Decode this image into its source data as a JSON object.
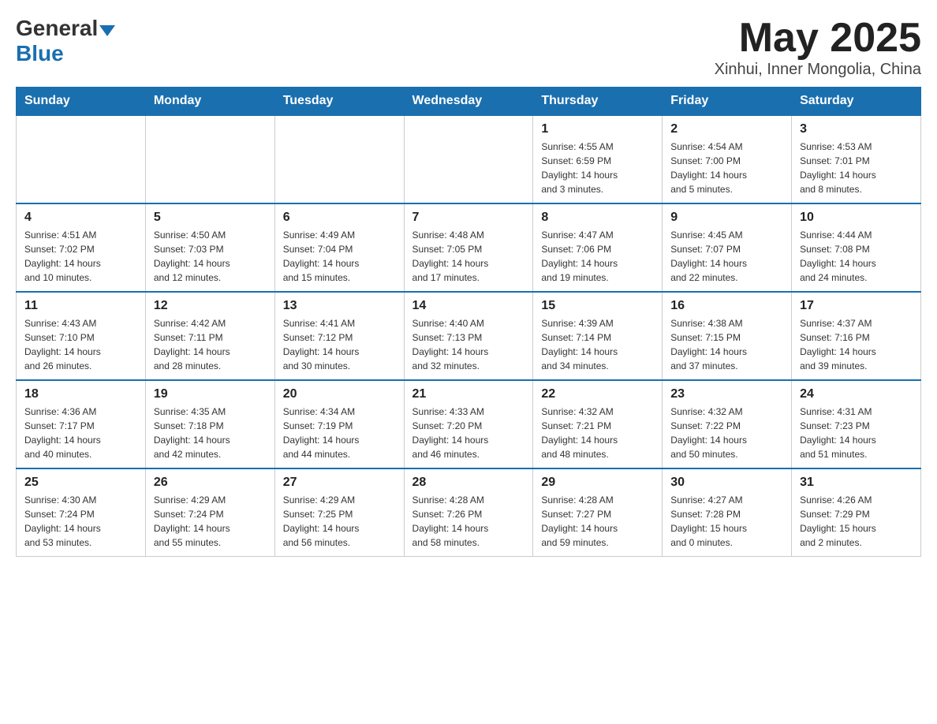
{
  "header": {
    "logo_general": "General",
    "logo_blue": "Blue",
    "month": "May 2025",
    "location": "Xinhui, Inner Mongolia, China"
  },
  "days_of_week": [
    "Sunday",
    "Monday",
    "Tuesday",
    "Wednesday",
    "Thursday",
    "Friday",
    "Saturday"
  ],
  "weeks": [
    [
      {
        "day": "",
        "info": ""
      },
      {
        "day": "",
        "info": ""
      },
      {
        "day": "",
        "info": ""
      },
      {
        "day": "",
        "info": ""
      },
      {
        "day": "1",
        "info": "Sunrise: 4:55 AM\nSunset: 6:59 PM\nDaylight: 14 hours\nand 3 minutes."
      },
      {
        "day": "2",
        "info": "Sunrise: 4:54 AM\nSunset: 7:00 PM\nDaylight: 14 hours\nand 5 minutes."
      },
      {
        "day": "3",
        "info": "Sunrise: 4:53 AM\nSunset: 7:01 PM\nDaylight: 14 hours\nand 8 minutes."
      }
    ],
    [
      {
        "day": "4",
        "info": "Sunrise: 4:51 AM\nSunset: 7:02 PM\nDaylight: 14 hours\nand 10 minutes."
      },
      {
        "day": "5",
        "info": "Sunrise: 4:50 AM\nSunset: 7:03 PM\nDaylight: 14 hours\nand 12 minutes."
      },
      {
        "day": "6",
        "info": "Sunrise: 4:49 AM\nSunset: 7:04 PM\nDaylight: 14 hours\nand 15 minutes."
      },
      {
        "day": "7",
        "info": "Sunrise: 4:48 AM\nSunset: 7:05 PM\nDaylight: 14 hours\nand 17 minutes."
      },
      {
        "day": "8",
        "info": "Sunrise: 4:47 AM\nSunset: 7:06 PM\nDaylight: 14 hours\nand 19 minutes."
      },
      {
        "day": "9",
        "info": "Sunrise: 4:45 AM\nSunset: 7:07 PM\nDaylight: 14 hours\nand 22 minutes."
      },
      {
        "day": "10",
        "info": "Sunrise: 4:44 AM\nSunset: 7:08 PM\nDaylight: 14 hours\nand 24 minutes."
      }
    ],
    [
      {
        "day": "11",
        "info": "Sunrise: 4:43 AM\nSunset: 7:10 PM\nDaylight: 14 hours\nand 26 minutes."
      },
      {
        "day": "12",
        "info": "Sunrise: 4:42 AM\nSunset: 7:11 PM\nDaylight: 14 hours\nand 28 minutes."
      },
      {
        "day": "13",
        "info": "Sunrise: 4:41 AM\nSunset: 7:12 PM\nDaylight: 14 hours\nand 30 minutes."
      },
      {
        "day": "14",
        "info": "Sunrise: 4:40 AM\nSunset: 7:13 PM\nDaylight: 14 hours\nand 32 minutes."
      },
      {
        "day": "15",
        "info": "Sunrise: 4:39 AM\nSunset: 7:14 PM\nDaylight: 14 hours\nand 34 minutes."
      },
      {
        "day": "16",
        "info": "Sunrise: 4:38 AM\nSunset: 7:15 PM\nDaylight: 14 hours\nand 37 minutes."
      },
      {
        "day": "17",
        "info": "Sunrise: 4:37 AM\nSunset: 7:16 PM\nDaylight: 14 hours\nand 39 minutes."
      }
    ],
    [
      {
        "day": "18",
        "info": "Sunrise: 4:36 AM\nSunset: 7:17 PM\nDaylight: 14 hours\nand 40 minutes."
      },
      {
        "day": "19",
        "info": "Sunrise: 4:35 AM\nSunset: 7:18 PM\nDaylight: 14 hours\nand 42 minutes."
      },
      {
        "day": "20",
        "info": "Sunrise: 4:34 AM\nSunset: 7:19 PM\nDaylight: 14 hours\nand 44 minutes."
      },
      {
        "day": "21",
        "info": "Sunrise: 4:33 AM\nSunset: 7:20 PM\nDaylight: 14 hours\nand 46 minutes."
      },
      {
        "day": "22",
        "info": "Sunrise: 4:32 AM\nSunset: 7:21 PM\nDaylight: 14 hours\nand 48 minutes."
      },
      {
        "day": "23",
        "info": "Sunrise: 4:32 AM\nSunset: 7:22 PM\nDaylight: 14 hours\nand 50 minutes."
      },
      {
        "day": "24",
        "info": "Sunrise: 4:31 AM\nSunset: 7:23 PM\nDaylight: 14 hours\nand 51 minutes."
      }
    ],
    [
      {
        "day": "25",
        "info": "Sunrise: 4:30 AM\nSunset: 7:24 PM\nDaylight: 14 hours\nand 53 minutes."
      },
      {
        "day": "26",
        "info": "Sunrise: 4:29 AM\nSunset: 7:24 PM\nDaylight: 14 hours\nand 55 minutes."
      },
      {
        "day": "27",
        "info": "Sunrise: 4:29 AM\nSunset: 7:25 PM\nDaylight: 14 hours\nand 56 minutes."
      },
      {
        "day": "28",
        "info": "Sunrise: 4:28 AM\nSunset: 7:26 PM\nDaylight: 14 hours\nand 58 minutes."
      },
      {
        "day": "29",
        "info": "Sunrise: 4:28 AM\nSunset: 7:27 PM\nDaylight: 14 hours\nand 59 minutes."
      },
      {
        "day": "30",
        "info": "Sunrise: 4:27 AM\nSunset: 7:28 PM\nDaylight: 15 hours\nand 0 minutes."
      },
      {
        "day": "31",
        "info": "Sunrise: 4:26 AM\nSunset: 7:29 PM\nDaylight: 15 hours\nand 2 minutes."
      }
    ]
  ]
}
